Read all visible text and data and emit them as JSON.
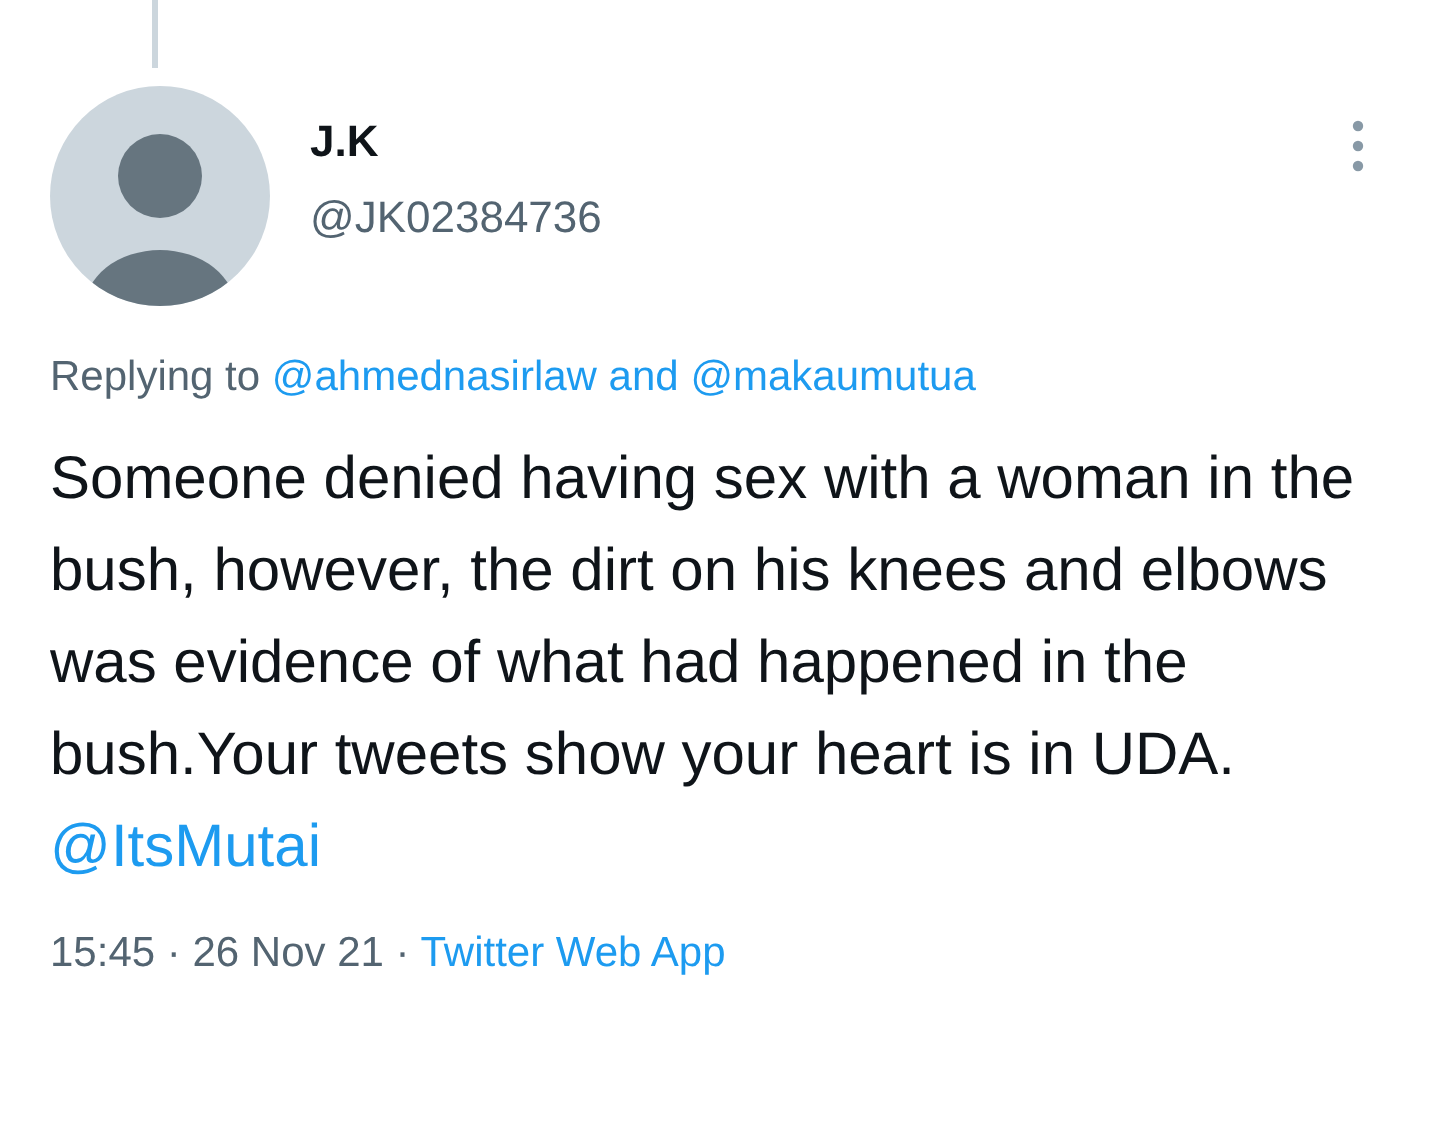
{
  "author": {
    "name": "J.K",
    "handle": "@JK02384736"
  },
  "replying": {
    "prefix": "Replying to",
    "mentions": [
      "@ahmednasirlaw",
      "@makaumutua"
    ],
    "joiner": "and"
  },
  "body": {
    "text": "Someone denied having sex with a woman in the bush, however, the dirt on his knees and elbows was evidence of what had happened in the bush.Your tweets show your heart is in UDA.",
    "mention": "@ItsMutai"
  },
  "meta": {
    "time": "15:45 · 26 Nov 21 ·",
    "source": "Twitter Web App"
  }
}
